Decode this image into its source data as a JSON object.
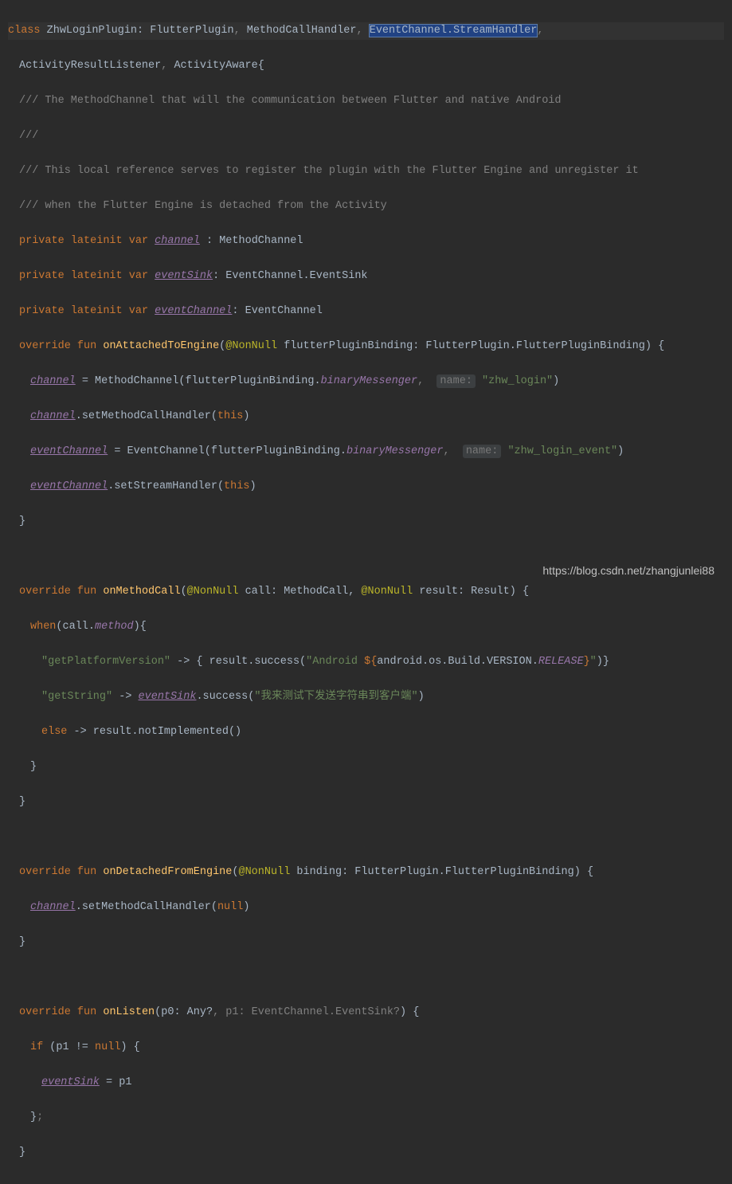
{
  "lines": {
    "l1_class": "class",
    "l1_name": " ZhwLoginPlugin",
    "l1_colon": ": FlutterPlugin",
    "l1_comma1": ", ",
    "l1_intf2": "MethodCallHandler",
    "l1_comma2": ", ",
    "l1_selected": "EventChannel.StreamHandler",
    "l1_comma3": ",",
    "l2": "ActivityResultListener",
    "l2_comma": ", ",
    "l2_b": "ActivityAware{",
    "c1": "/// The MethodChannel that will the communication between Flutter and native Android",
    "c2": "///",
    "c3": "/// This local reference serves to register the plugin with the Flutter Engine and unregister it",
    "c4": "/// when the Flutter Engine is detached from the Activity",
    "priv": "private",
    "lateinit": "lateinit",
    "var": "var",
    "channel": "channel",
    "channel_type": " : MethodChannel",
    "eventSink": "eventSink",
    "eventSink_type": ": EventChannel.EventSink",
    "eventChannel": "eventChannel",
    "eventChannel_type": ": EventChannel",
    "override": "override",
    "fun": "fun",
    "onAttached": "onAttachedToEngine",
    "nonNull": "@NonNull",
    "fpb_param": " flutterPluginBinding: FlutterPlugin.FlutterPluginBinding) {",
    "ch_assign": " = MethodChannel(flutterPluginBinding.",
    "binaryMsg": "binaryMessenger",
    "name_hint": "name:",
    "zhw_login": "\"zhw_login\"",
    "close_paren": ")",
    "setMCH": ".setMethodCallHandler(",
    "this_kw": "this",
    "ec_assign": " = EventChannel(flutterPluginBinding.",
    "zhw_event": "\"zhw_login_event\"",
    "setSH": ".setStreamHandler(",
    "brace_close": "}",
    "onMethodCall": "onMethodCall",
    "call_param": " call: MethodCall, ",
    "result_param": " result: Result) {",
    "when": "when",
    "call_method": "(call.",
    "method_prop": "method",
    "brace_open": "){",
    "getPlat": "\"getPlatformVersion\"",
    "arrow": " -> { result.success(",
    "android_str": "\"Android ",
    "dollar": "${",
    "android_build": "android.os.Build.VERSION.",
    "release": "RELEASE",
    "end_brace": "}",
    "quote": "\"",
    "close2": ")}",
    "getString": "\"getString\"",
    "arrow2": " -> ",
    "success": ".success(",
    "chinese": "\"我来测试下发送字符串到客户端\"",
    "else_kw": "else",
    "notImpl": " -> result.notImplemented()",
    "onDetached": "onDetachedFromEngine",
    "binding_param": " binding: FlutterPlugin.FlutterPluginBinding) {",
    "null_kw": "null",
    "onListen": "onListen",
    "p0_param": "(p0: Any?",
    "p1_param": ", p1: EventChannel.EventSink?",
    "brace3": ") {",
    "if_kw": "if",
    "if_cond": " (p1 != ",
    "brace4": ") {",
    "assign_p1": " = p1",
    "brace_semi": "}",
    "semi": ";"
  },
  "watermark": "https://blog.csdn.net/zhangjunlei88"
}
